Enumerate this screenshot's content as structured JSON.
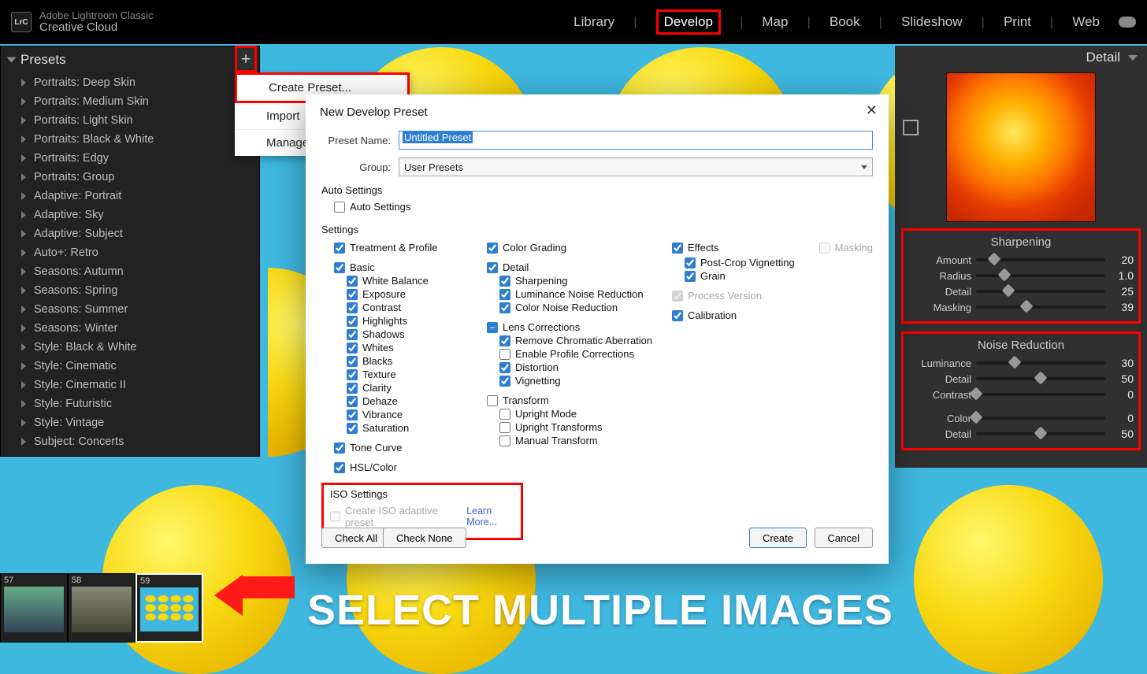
{
  "brand": {
    "line1": "Adobe Lightroom Classic",
    "line2": "Creative Cloud",
    "logo": "LrC"
  },
  "modules": {
    "library": "Library",
    "develop": "Develop",
    "map": "Map",
    "book": "Book",
    "slideshow": "Slideshow",
    "print": "Print",
    "web": "Web"
  },
  "presets_panel": {
    "title": "Presets",
    "items": [
      "Portraits: Deep Skin",
      "Portraits: Medium Skin",
      "Portraits: Light Skin",
      "Portraits: Black & White",
      "Portraits: Edgy",
      "Portraits: Group",
      "Adaptive: Portrait",
      "Adaptive: Sky",
      "Adaptive: Subject",
      "Auto+: Retro",
      "Seasons: Autumn",
      "Seasons: Spring",
      "Seasons: Summer",
      "Seasons: Winter",
      "Style: Black & White",
      "Style: Cinematic",
      "Style: Cinematic II",
      "Style: Futuristic",
      "Style: Vintage",
      "Subject: Concerts"
    ]
  },
  "plus_menu": {
    "create": "Create Preset...",
    "import": "Import",
    "manage": "Manage"
  },
  "dialog": {
    "title": "New Develop Preset",
    "preset_name_label": "Preset Name:",
    "preset_name_value": "Untitled Preset",
    "group_label": "Group:",
    "group_value": "User Presets",
    "auto_settings_title": "Auto Settings",
    "auto_settings": "Auto Settings",
    "settings_title": "Settings",
    "col1": {
      "treatment": "Treatment & Profile",
      "basic": "Basic",
      "white_balance": "White Balance",
      "exposure": "Exposure",
      "contrast": "Contrast",
      "highlights": "Highlights",
      "shadows": "Shadows",
      "whites": "Whites",
      "blacks": "Blacks",
      "texture": "Texture",
      "clarity": "Clarity",
      "dehaze": "Dehaze",
      "vibrance": "Vibrance",
      "saturation": "Saturation",
      "tone_curve": "Tone Curve",
      "hsl": "HSL/Color"
    },
    "col2": {
      "color_grading": "Color Grading",
      "detail": "Detail",
      "sharpening": "Sharpening",
      "lum_nr": "Luminance Noise Reduction",
      "color_nr": "Color Noise Reduction",
      "lens": "Lens Corrections",
      "remove_ca": "Remove Chromatic Aberration",
      "enable_profile": "Enable Profile Corrections",
      "distortion": "Distortion",
      "vignetting": "Vignetting",
      "transform": "Transform",
      "upright_mode": "Upright Mode",
      "upright_t": "Upright Transforms",
      "manual_t": "Manual Transform"
    },
    "col3": {
      "effects": "Effects",
      "pcv": "Post-Crop Vignetting",
      "grain": "Grain",
      "masking": "Masking",
      "process": "Process Version",
      "calibration": "Calibration"
    },
    "iso": {
      "title": "ISO Settings",
      "label": "Create ISO adaptive preset",
      "learn": "Learn More..."
    },
    "buttons": {
      "check_all": "Check All",
      "check_none": "Check None",
      "create": "Create",
      "cancel": "Cancel"
    }
  },
  "right_panel": {
    "title": "Detail",
    "sharpening": {
      "title": "Sharpening",
      "amount": {
        "label": "Amount",
        "val": "20",
        "pct": 14
      },
      "radius": {
        "label": "Radius",
        "val": "1.0",
        "pct": 22
      },
      "detail": {
        "label": "Detail",
        "val": "25",
        "pct": 25
      },
      "masking": {
        "label": "Masking",
        "val": "39",
        "pct": 39
      }
    },
    "noise": {
      "title": "Noise Reduction",
      "luminance": {
        "label": "Luminance",
        "val": "30",
        "pct": 30
      },
      "detail": {
        "label": "Detail",
        "val": "50",
        "pct": 50
      },
      "contrast": {
        "label": "Contrast",
        "val": "0",
        "pct": 0
      },
      "color": {
        "label": "Color",
        "val": "0",
        "pct": 0
      },
      "detail2": {
        "label": "Detail",
        "val": "50",
        "pct": 50
      }
    }
  },
  "filmstrip": {
    "n1": "57",
    "n2": "58",
    "n3": "59"
  },
  "caption": "SELECT MULTIPLE IMAGES"
}
